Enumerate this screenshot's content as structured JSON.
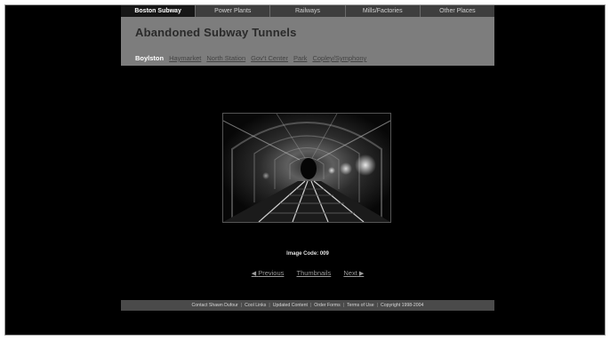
{
  "top_nav": [
    {
      "label": "Boston Subway",
      "active": true
    },
    {
      "label": "Power Plants",
      "active": false
    },
    {
      "label": "Railways",
      "active": false
    },
    {
      "label": "Mills/Factories",
      "active": false
    },
    {
      "label": "Other Places",
      "active": false
    }
  ],
  "header": {
    "title": "Abandoned Subway Tunnels"
  },
  "sub_nav": [
    {
      "label": "Boylston",
      "active": true
    },
    {
      "label": "Haymarket",
      "active": false
    },
    {
      "label": "North Station",
      "active": false
    },
    {
      "label": "Gov't Center",
      "active": false
    },
    {
      "label": "Park",
      "active": false
    },
    {
      "label": "Copley/Symphony",
      "active": false
    }
  ],
  "photo": {
    "icon": "tunnel-photo"
  },
  "image_code": "Image Code: 009",
  "pager": {
    "previous": "Previous",
    "thumbnails": "Thumbnails",
    "next": "Next",
    "prev_arrow": "◀",
    "next_arrow": "▶"
  },
  "footer": {
    "links": [
      "Contact Shawn Dufour",
      "Cool Links",
      "Updated Content",
      "Order Forms",
      "Terms of Use"
    ],
    "copyright": "Copyright 1998-2004"
  },
  "colors": {
    "page_bg": "#000000",
    "header_bg": "#7d7d7d",
    "nav_bg": "#3e3e3e",
    "footer_bg": "#4a4a4a"
  }
}
